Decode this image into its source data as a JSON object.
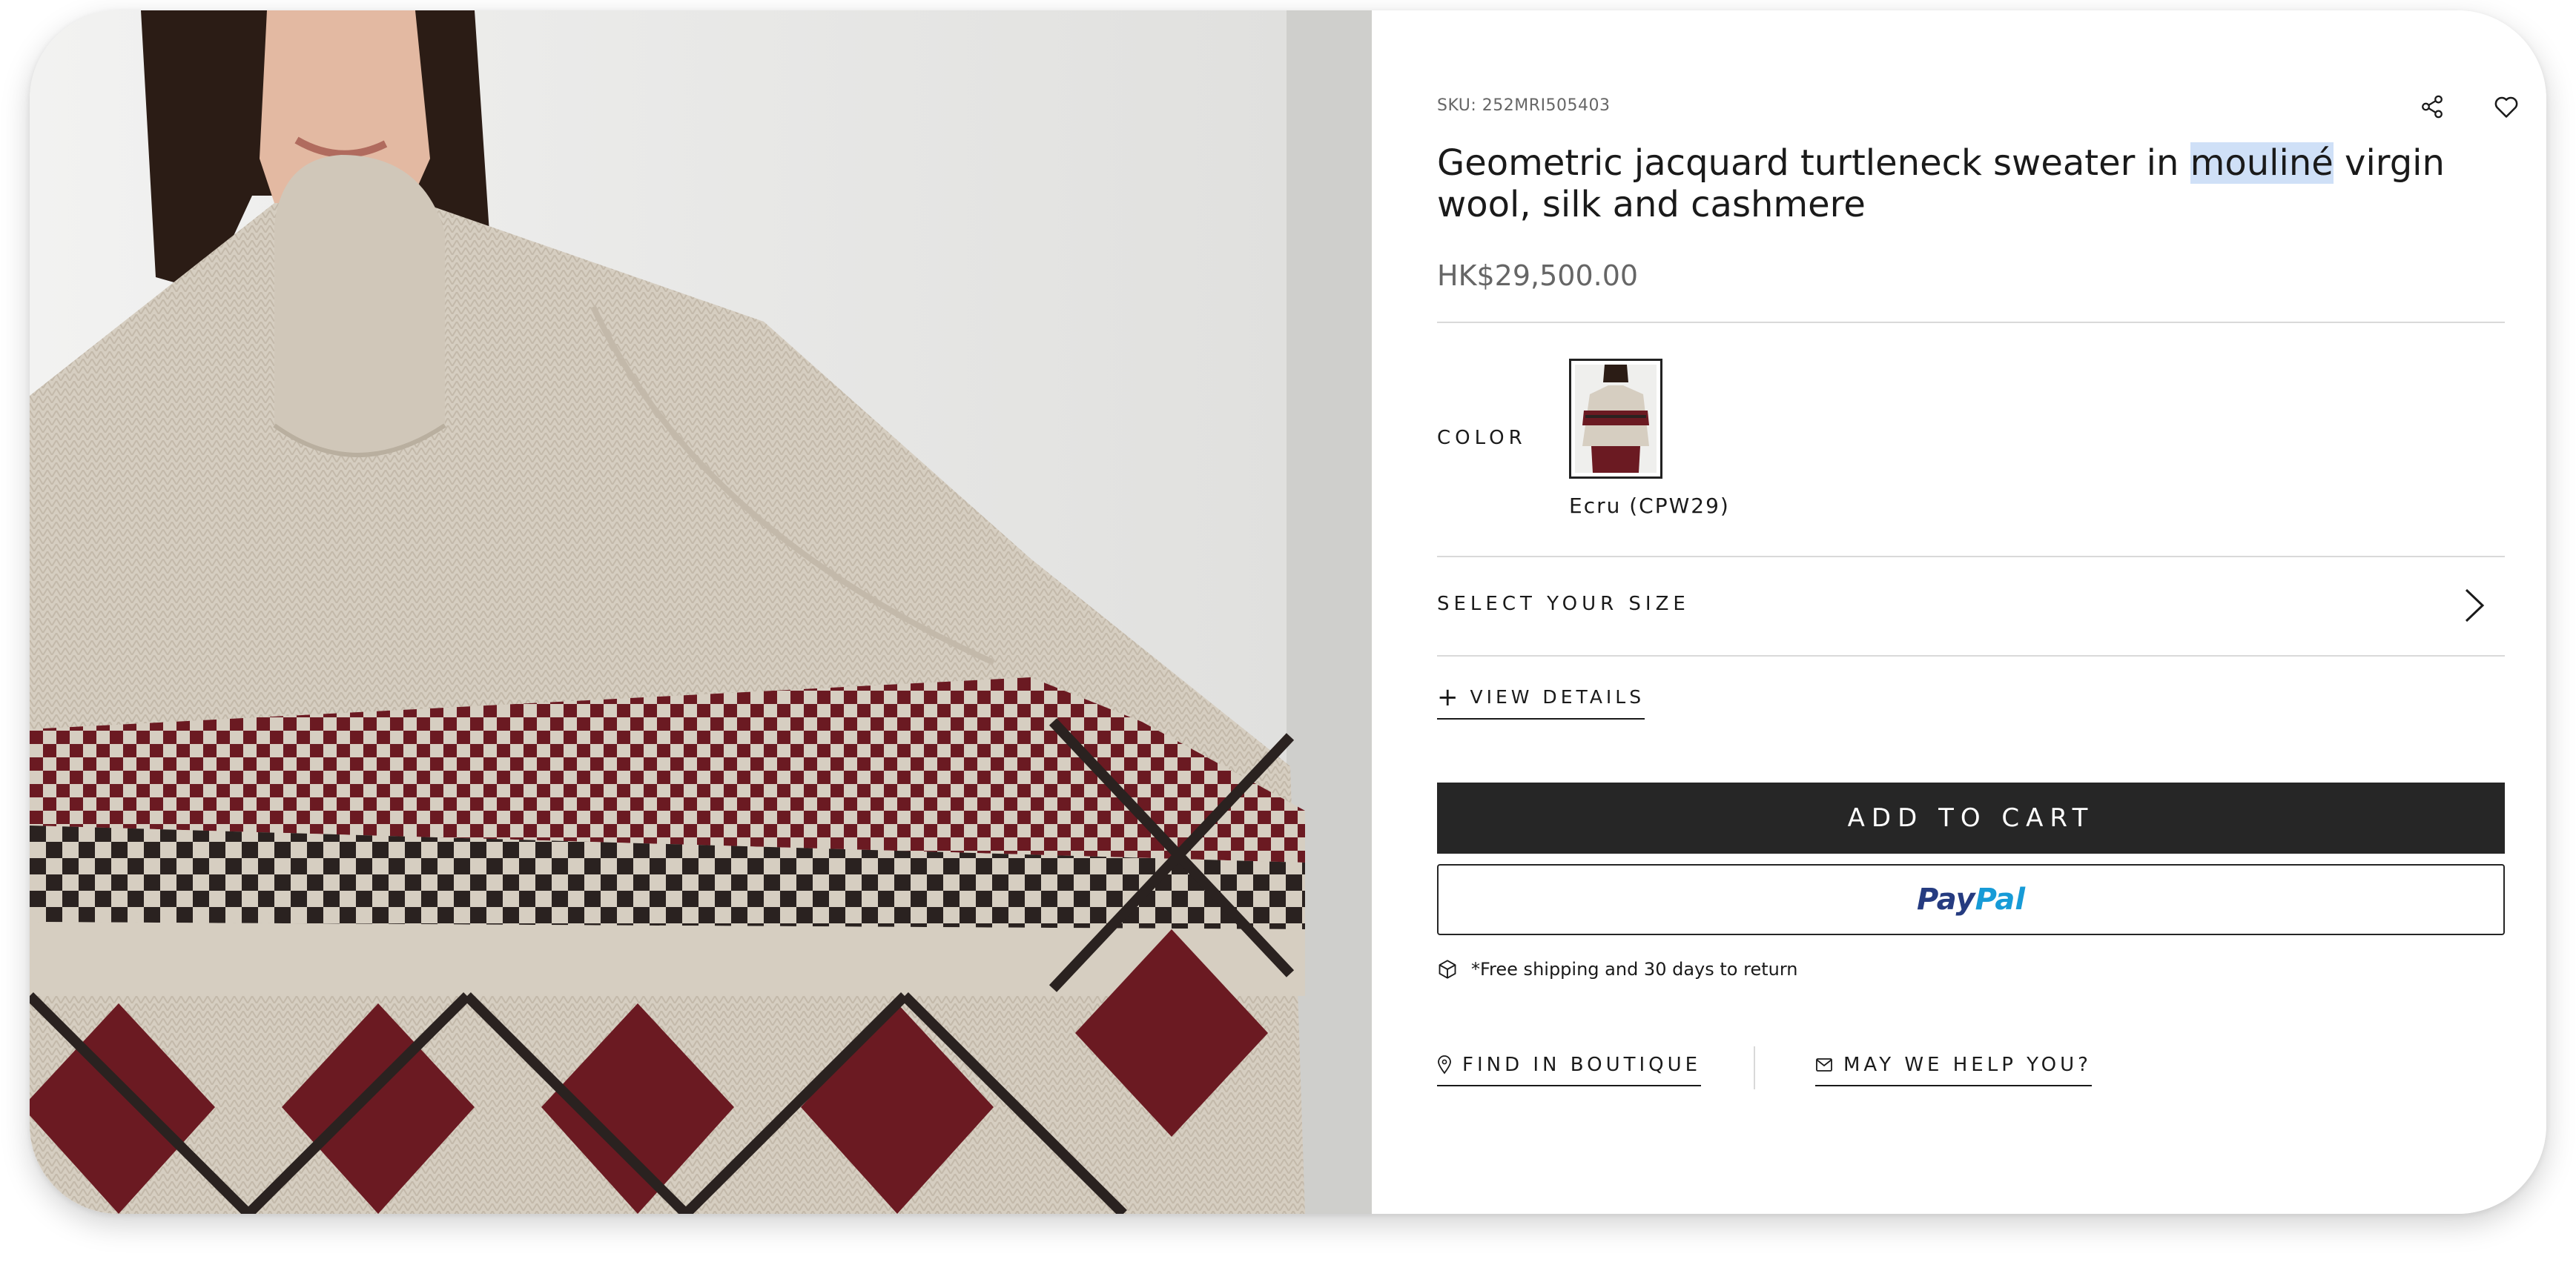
{
  "product": {
    "sku": "SKU: 252MRI505403",
    "title_before": "Geometric jacquard turtleneck sweater in ",
    "title_highlight": "mouliné",
    "title_after": " virgin wool, silk and cashmere",
    "price": "HK$29,500.00"
  },
  "actions": {
    "share_icon": "share-icon",
    "wishlist_icon": "heart-icon"
  },
  "color": {
    "label": "COLOR",
    "selected_swatch": "Ecru (CPW29)"
  },
  "size": {
    "label": "SELECT YOUR SIZE"
  },
  "details": {
    "label": "VIEW DETAILS"
  },
  "cart": {
    "add_label": "ADD TO CART",
    "paypal_part1": "Pay",
    "paypal_part2": "Pal"
  },
  "shipping": {
    "text": "*Free shipping and 30 days to return"
  },
  "footer_links": {
    "find": "FIND IN BOUTIQUE",
    "help": "MAY WE HELP YOU?"
  },
  "colors": {
    "button_dark": "#262626",
    "highlight": "#cfe0f7",
    "paypal_dark": "#253b80",
    "paypal_light": "#179bd7",
    "knit_base": "#d9d1c5",
    "knit_burgundy": "#6b1a22",
    "knit_dark": "#2a2220"
  }
}
